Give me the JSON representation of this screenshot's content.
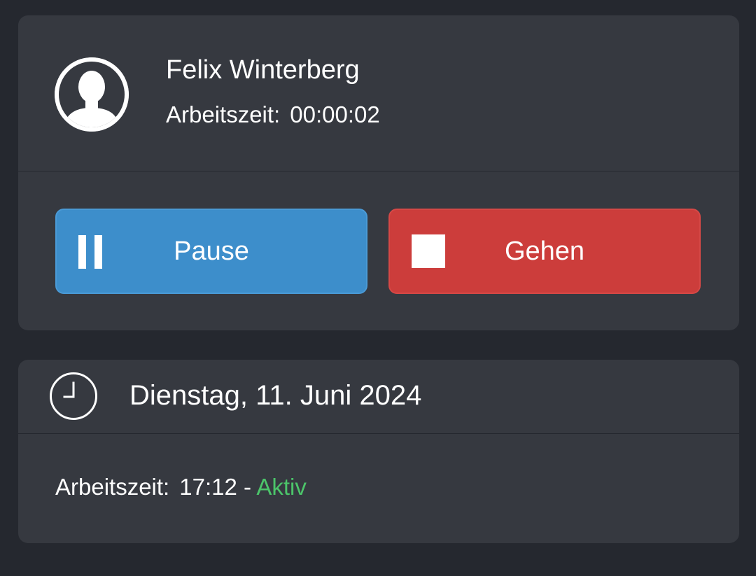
{
  "user": {
    "name": "Felix Winterberg",
    "worktime_label": "Arbeitszeit:",
    "worktime_value": "00:00:02"
  },
  "actions": {
    "pause_label": "Pause",
    "leave_label": "Gehen"
  },
  "day": {
    "date": "Dienstag, 11. Juni 2024",
    "worktime_label": "Arbeitszeit:",
    "worktime_value": "17:12 -",
    "status": "Aktiv"
  },
  "icons": {
    "avatar": "user-avatar-icon",
    "pause": "pause-icon",
    "stop": "stop-icon",
    "clock": "clock-icon"
  },
  "colors": {
    "background": "#25282f",
    "card": "#363940",
    "pause_button": "#3d8ecb",
    "leave_button": "#cc3d3b",
    "status_active": "#4cc46a"
  }
}
